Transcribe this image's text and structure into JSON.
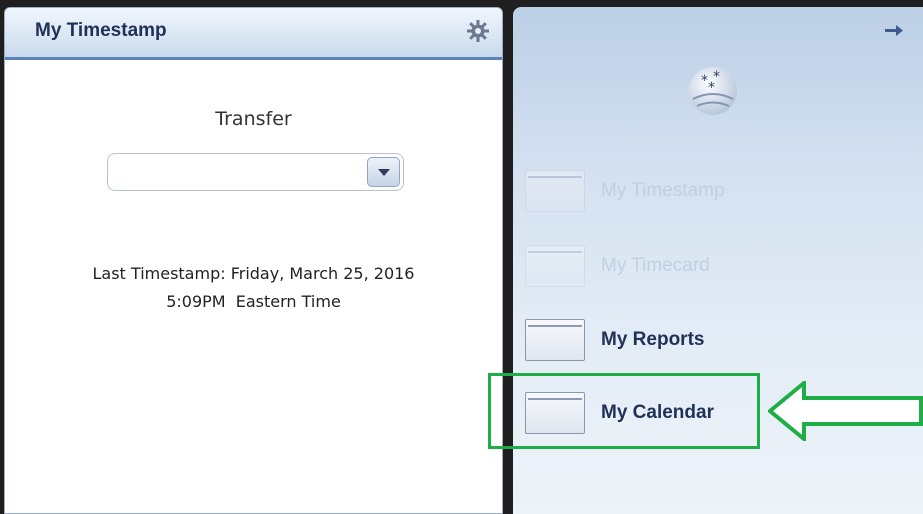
{
  "left_panel": {
    "title": "My Timestamp",
    "transfer_label": "Transfer",
    "transfer_value": "",
    "last_timestamp_line1": "Last Timestamp: Friday, March 25, 2016",
    "last_timestamp_line2": "5:09PM  Eastern Time"
  },
  "right_panel": {
    "nav_items": [
      {
        "label": "My Timestamp",
        "enabled": false
      },
      {
        "label": "My Timecard",
        "enabled": false
      },
      {
        "label": "My Reports",
        "enabled": true
      },
      {
        "label": "My Calendar",
        "enabled": true,
        "highlighted": true
      }
    ]
  },
  "icons": {
    "gear": "gear-icon",
    "pin": "pin-icon",
    "globe": "globe-icon",
    "dropdown": "chevron-down-icon",
    "callout_arrow": "arrow-left-icon"
  },
  "colors": {
    "header_border": "#5b82b8",
    "title_text": "#1f3256",
    "highlight": "#1fae45"
  }
}
